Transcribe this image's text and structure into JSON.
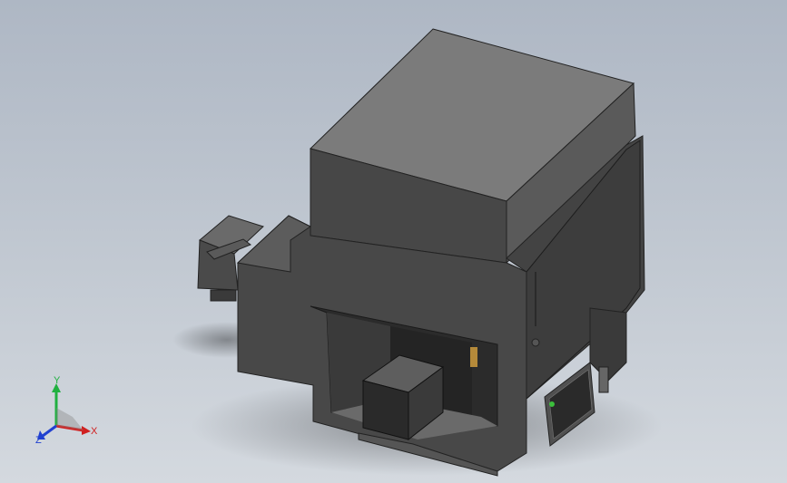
{
  "viewport": {
    "background_top": "#aeb7c4",
    "background_bottom": "#d4d9df"
  },
  "model": {
    "body_color": "#484848",
    "top_color": "#7b7b7b",
    "dark_color": "#2f2f2f",
    "accent_color": "#b58a3a"
  },
  "triad": {
    "x_label": "X",
    "y_label": "Y",
    "z_label": "Z",
    "x_color": "#d02020",
    "y_color": "#20b040",
    "z_color": "#2040d0"
  }
}
